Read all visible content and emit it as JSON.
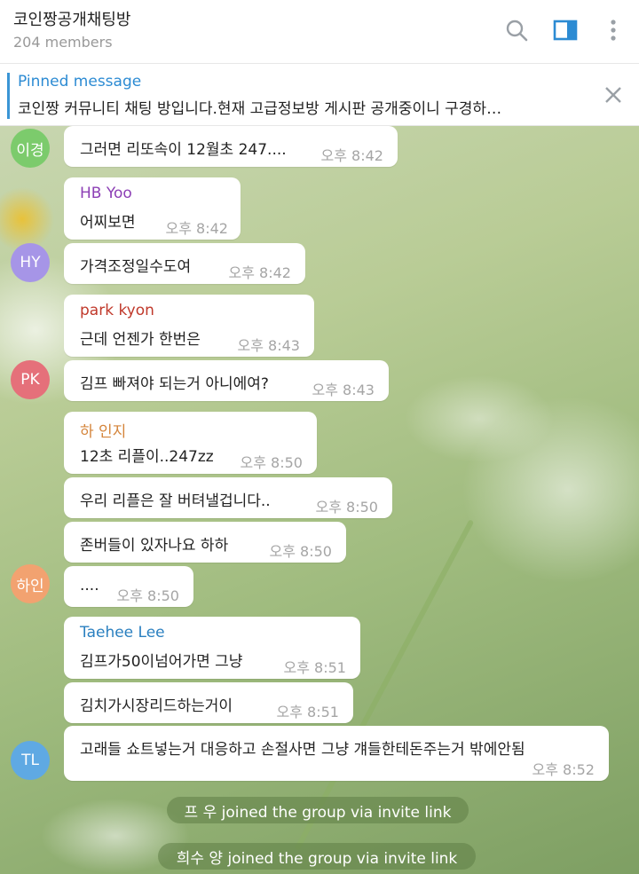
{
  "header": {
    "title": "코인짱공개채팅방",
    "members": "204 members"
  },
  "pinned": {
    "title": "Pinned message",
    "text": "코인짱 커뮤니티 채팅 방입니다.현재 고급정보방 게시판 공개중이니 구경하…"
  },
  "messages": [
    {
      "text": "그러면 리또속이 12월초 247....",
      "time": "오후 8:42"
    },
    {
      "sender": "HB Yoo",
      "text": "어찌보면",
      "time": "오후 8:42"
    },
    {
      "text": "가격조정일수도여",
      "time": "오후 8:42"
    },
    {
      "sender": "park kyon",
      "text": "근데 언젠가 한번은",
      "time": "오후 8:43"
    },
    {
      "text": "김프 빠져야 되는거 아니에여?",
      "time": "오후 8:43"
    },
    {
      "sender": "하 인지",
      "text": "12초 리플이..247zz",
      "time": "오후 8:50"
    },
    {
      "text": "우리 리플은 잘 버텨낼겁니다..",
      "time": "오후 8:50"
    },
    {
      "text": "존버들이 있자나요 하하",
      "time": "오후 8:50"
    },
    {
      "text": "....",
      "time": "오후 8:50"
    },
    {
      "sender": "Taehee Lee",
      "text": "김프가50이넘어가면 그냥",
      "time": "오후 8:51"
    },
    {
      "text": "김치가시장리드하는거이",
      "time": "오후 8:51"
    },
    {
      "text": "고래들 쇼트넣는거 대응하고 손절사면 그냥 걔들한테돈주는거 밖에안됨",
      "time": "오후 8:52"
    }
  ],
  "avatars": [
    {
      "initials": "이경",
      "color": "#7ccb6c"
    },
    {
      "initials": "HY",
      "color": "#a695e7"
    },
    {
      "initials": "PK",
      "color": "#e5707a"
    },
    {
      "initials": "하인",
      "color": "#f2a270"
    },
    {
      "initials": "TL",
      "color": "#5fa9e3"
    }
  ],
  "service": [
    "프 우 joined the group via invite link",
    "희수 양 joined the group via invite link"
  ],
  "colors": {
    "accent": "#2c8bd3",
    "sender_hb": "#8c3fb5",
    "sender_pk": "#c0392b",
    "sender_ha": "#d4843a",
    "sender_tl": "#2b80c0"
  },
  "icons": [
    "search-icon",
    "sidebar-toggle-icon",
    "more-vertical-icon",
    "close-icon"
  ]
}
